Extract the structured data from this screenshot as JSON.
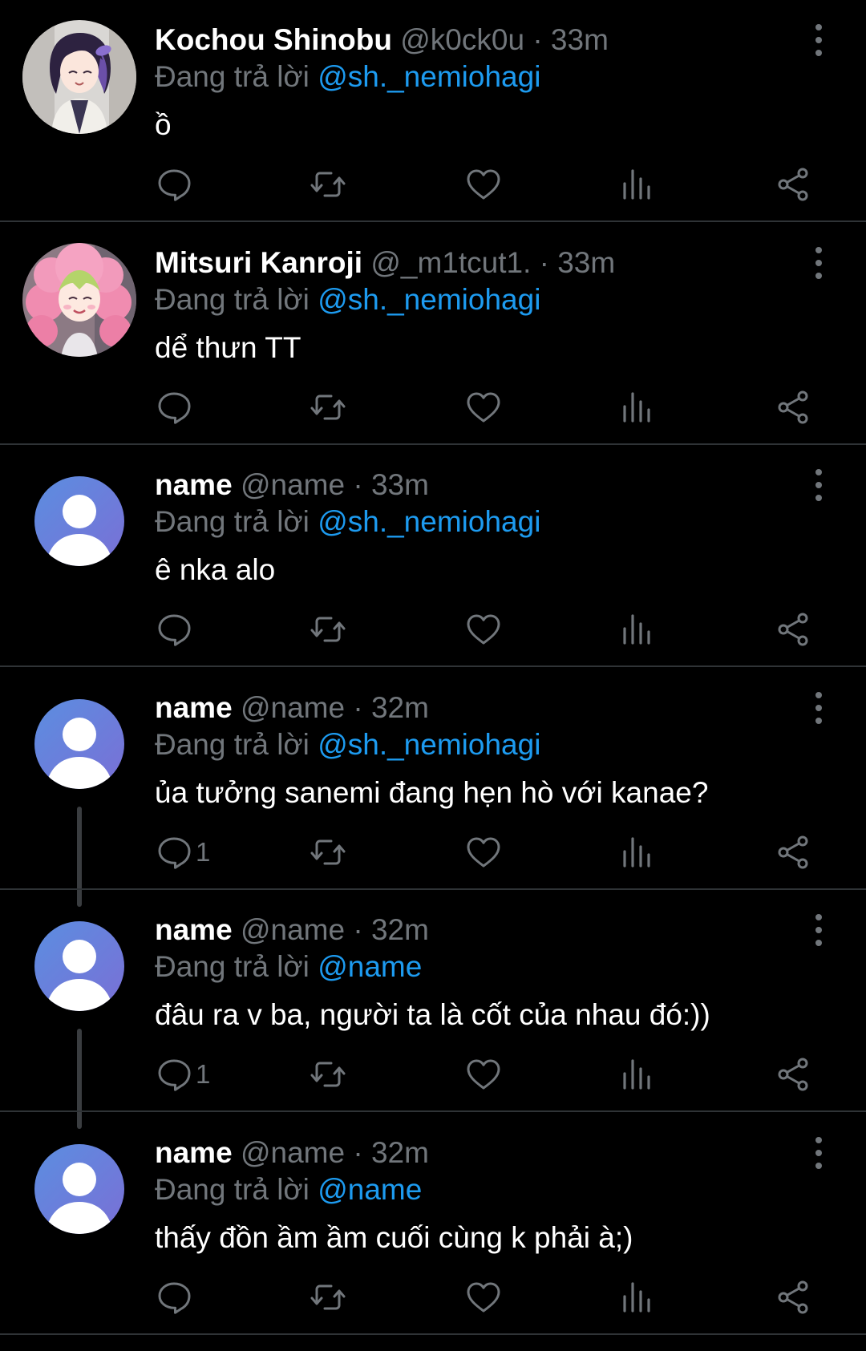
{
  "colors": {
    "background": "#000000",
    "divider": "#2f3336",
    "muted": "#71767b",
    "mention": "#1d9bf0",
    "text": "#ffffff",
    "default_avatar_gradient": [
      "#5b8ee0",
      "#7a6fd6"
    ]
  },
  "icons": {
    "reply": "reply-bubble-icon",
    "retweet": "retweet-icon",
    "like": "heart-icon",
    "views": "views-bar-chart-icon",
    "share": "share-icon",
    "more": "more-vertical-icon"
  },
  "tweets": [
    {
      "display_name": "Kochou Shinobu",
      "handle": "@k0ck0u",
      "separator": "·",
      "time": "33m",
      "reply_prefix": "Đang trả lời",
      "reply_to": "@sh._nemiohagi",
      "content": "ồ",
      "reply_count": "",
      "avatar": "shinobu"
    },
    {
      "display_name": "Mitsuri Kanroji",
      "handle": "@_m1tcut1.",
      "separator": "·",
      "time": "33m",
      "reply_prefix": "Đang trả lời",
      "reply_to": "@sh._nemiohagi",
      "content": "dể thưn TT",
      "reply_count": "",
      "avatar": "mitsuri"
    },
    {
      "display_name": "name",
      "handle": "@name",
      "separator": "·",
      "time": "33m",
      "reply_prefix": "Đang trả lời",
      "reply_to": "@sh._nemiohagi",
      "content": "ê nka alo",
      "reply_count": "",
      "avatar": "default"
    },
    {
      "display_name": "name",
      "handle": "@name",
      "separator": "·",
      "time": "32m",
      "reply_prefix": "Đang trả lời",
      "reply_to": "@sh._nemiohagi",
      "content": "ủa tưởng sanemi đang hẹn hò với kanae?",
      "reply_count": "1",
      "avatar": "default"
    },
    {
      "display_name": "name",
      "handle": "@name",
      "separator": "·",
      "time": "32m",
      "reply_prefix": "Đang trả lời",
      "reply_to": "@name",
      "content": "đâu ra v ba, người ta là cốt của nhau đó:))",
      "reply_count": "1",
      "avatar": "default"
    },
    {
      "display_name": "name",
      "handle": "@name",
      "separator": "·",
      "time": "32m",
      "reply_prefix": "Đang trả lời",
      "reply_to": "@name",
      "content": "thấy đồn ầm ầm cuối cùng k phải à;)",
      "reply_count": "",
      "avatar": "default"
    }
  ]
}
